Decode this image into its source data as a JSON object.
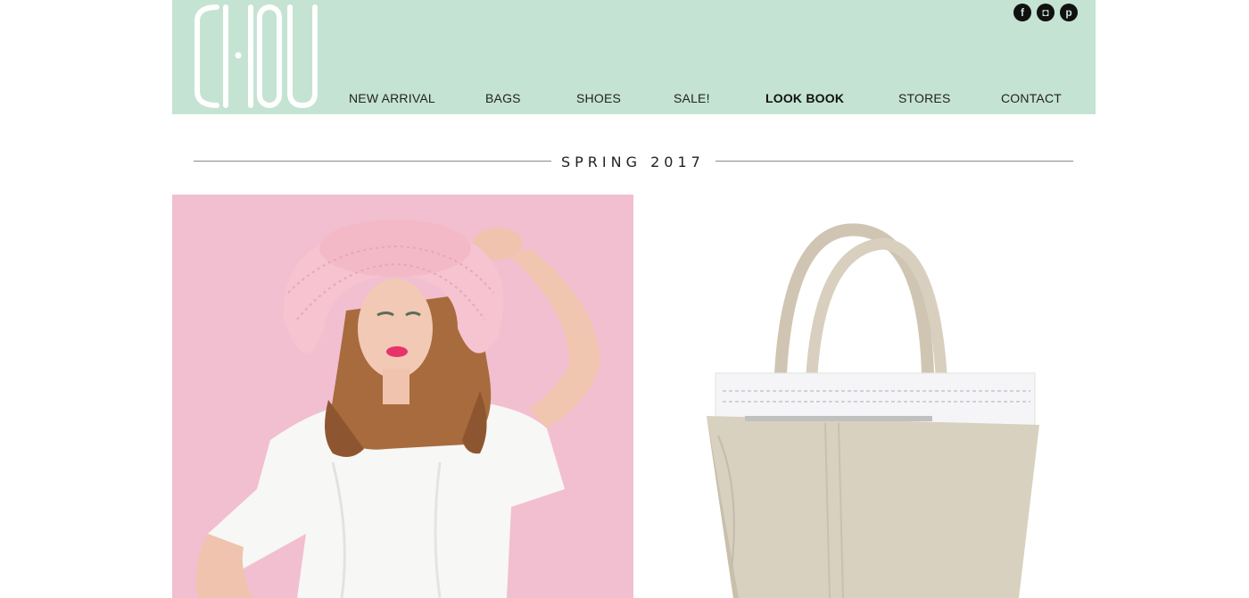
{
  "brand": {
    "logo_text": "CHOU"
  },
  "social": [
    {
      "name": "facebook-icon",
      "glyph": "f"
    },
    {
      "name": "instagram-icon",
      "glyph": "◘"
    },
    {
      "name": "pinterest-icon",
      "glyph": "p"
    }
  ],
  "nav": {
    "new_arrival": "NEW ARRIVAL",
    "bags": "BAGS",
    "shoes": "SHOES",
    "sale": "SALE!",
    "look_book": "LOOK BOOK",
    "stores": "STORES",
    "contact": "CONTACT"
  },
  "section": {
    "title": "SPRING 2017"
  },
  "colors": {
    "header_bg": "#c5e3d2",
    "left_photo_bg": "#f1bfd0",
    "text": "#222222"
  }
}
